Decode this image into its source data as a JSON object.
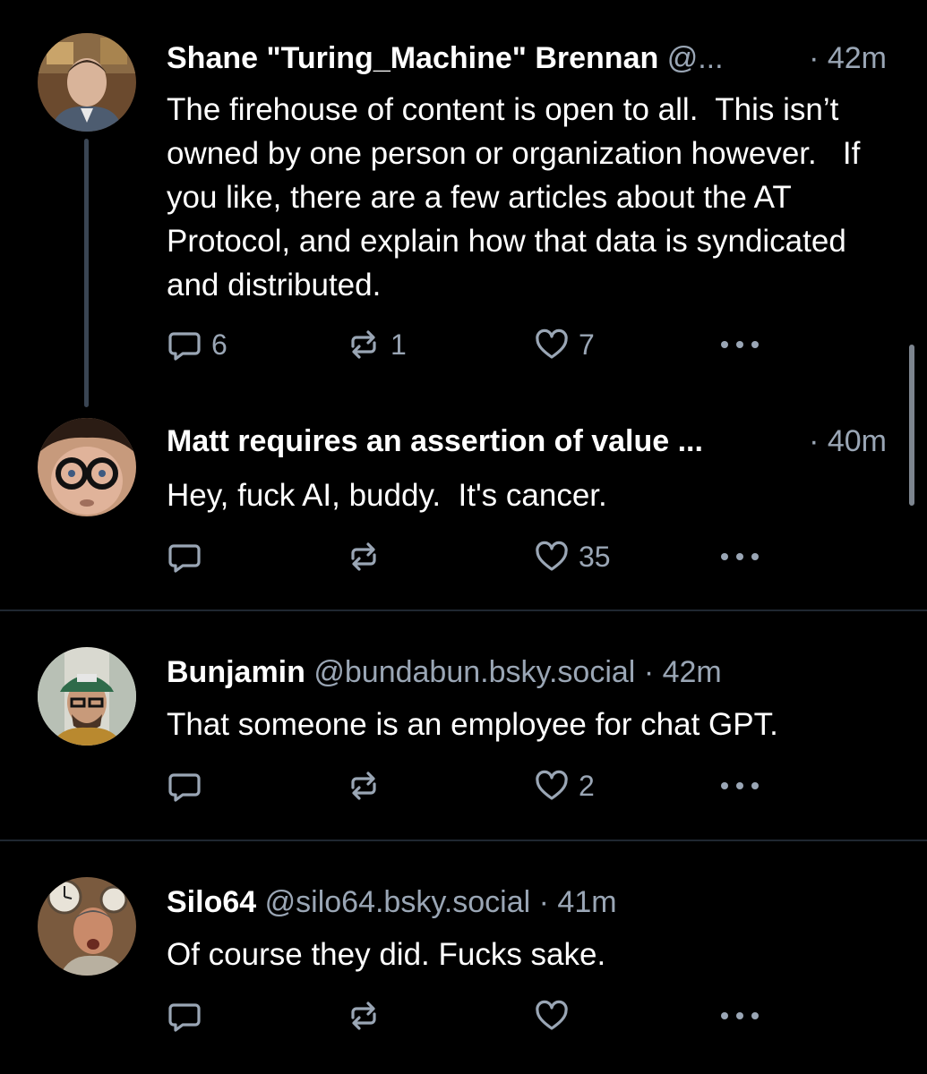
{
  "colors": {
    "background": "#000000",
    "text_primary": "#ffffff",
    "text_secondary": "#9aa6b5",
    "thread_line": "#3a4553",
    "divider": "#1f2731"
  },
  "posts": [
    {
      "display_name": "Shane \"Turing_Machine\" Brennan",
      "handle": "@...",
      "time": "· 42m",
      "text": "The firehouse of content is open to all.  This isn’t owned by one person or organization however.   If you like, there are a few articles about the AT Protocol, and explain how that data is syndicated and distributed.",
      "reply_count": "6",
      "repost_count": "1",
      "like_count": "7",
      "reply_icon": "reply-icon",
      "repost_icon": "repost-icon",
      "like_icon": "heart-icon",
      "more_icon": "more-icon"
    },
    {
      "display_name": "Matt requires an assertion of value ...",
      "handle": "",
      "time": "· 40m",
      "text": "Hey, fuck AI, buddy.  It's cancer.",
      "reply_count": "",
      "repost_count": "",
      "like_count": "35"
    },
    {
      "display_name": "Bunjamin",
      "handle": "@bundabun.bsky.social",
      "time": "· 42m",
      "text": "That someone is an employee for chat GPT.",
      "reply_count": "",
      "repost_count": "",
      "like_count": "2"
    },
    {
      "display_name": "Silo64",
      "handle": "@silo64.bsky.social",
      "time": "· 41m",
      "text": "Of course they did. Fucks sake.",
      "reply_count": "",
      "repost_count": "",
      "like_count": ""
    }
  ]
}
